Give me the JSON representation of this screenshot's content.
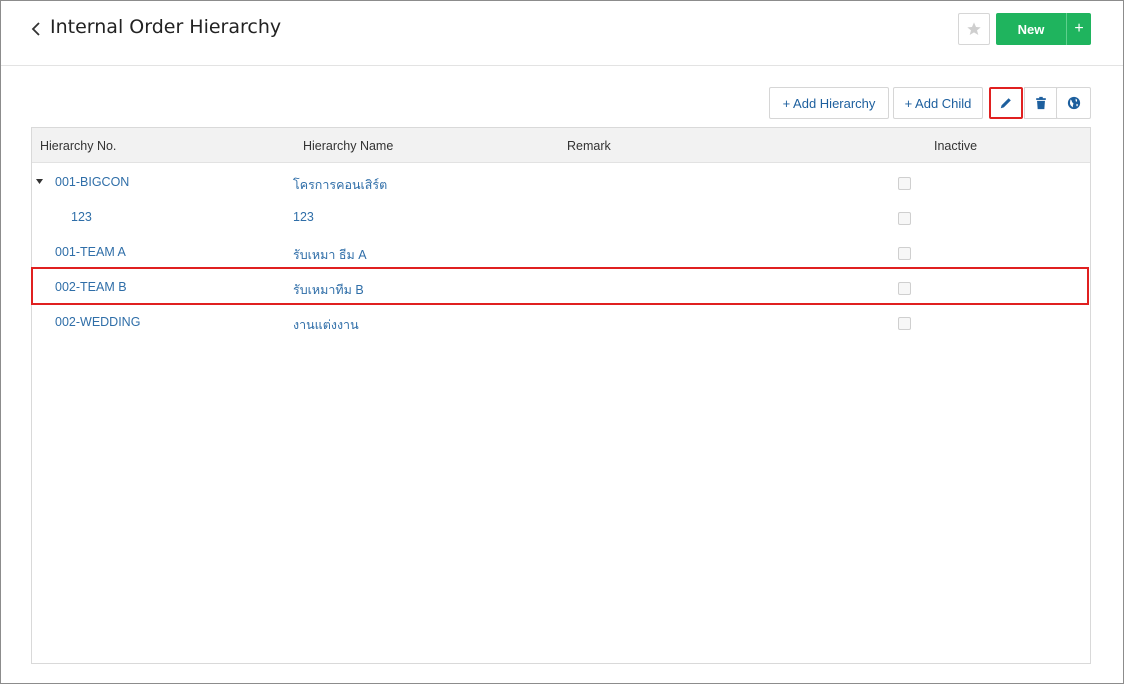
{
  "header": {
    "title": "Internal Order Hierarchy",
    "new_label": "New",
    "new_plus_label": "+"
  },
  "toolbar": {
    "add_hierarchy_label": "+ Add Hierarchy",
    "add_child_label": "+ Add Child"
  },
  "table": {
    "columns": [
      "Hierarchy No.",
      "Hierarchy Name",
      "Remark",
      "Inactive"
    ],
    "rows": [
      {
        "no": "001-BIGCON",
        "name": "โครการคอนเสิร์ต",
        "remark": "",
        "inactive": false,
        "expandable": true,
        "level": 0
      },
      {
        "no": "123",
        "name": "123",
        "remark": "",
        "inactive": false,
        "expandable": false,
        "level": 1
      },
      {
        "no": "001-TEAM A",
        "name": "รับเหมา ธีม A",
        "remark": "",
        "inactive": false,
        "expandable": false,
        "level": 0
      },
      {
        "no": "002-TEAM B",
        "name": "รับเหมาทีม B",
        "remark": "",
        "inactive": false,
        "expandable": false,
        "level": 0,
        "highlighted": true
      },
      {
        "no": "002-WEDDING",
        "name": "งานแต่งงาน",
        "remark": "",
        "inactive": false,
        "expandable": false,
        "level": 0
      }
    ]
  },
  "colors": {
    "accent_green": "#1fb45e",
    "link_blue": "#2f6ea8",
    "highlight_red": "#e02020"
  },
  "icons": {
    "back": "chevron-left-icon",
    "favorite": "star-icon",
    "edit": "pencil-icon",
    "delete": "trash-icon",
    "globe": "globe-icon",
    "expand": "triangle-down-icon"
  }
}
